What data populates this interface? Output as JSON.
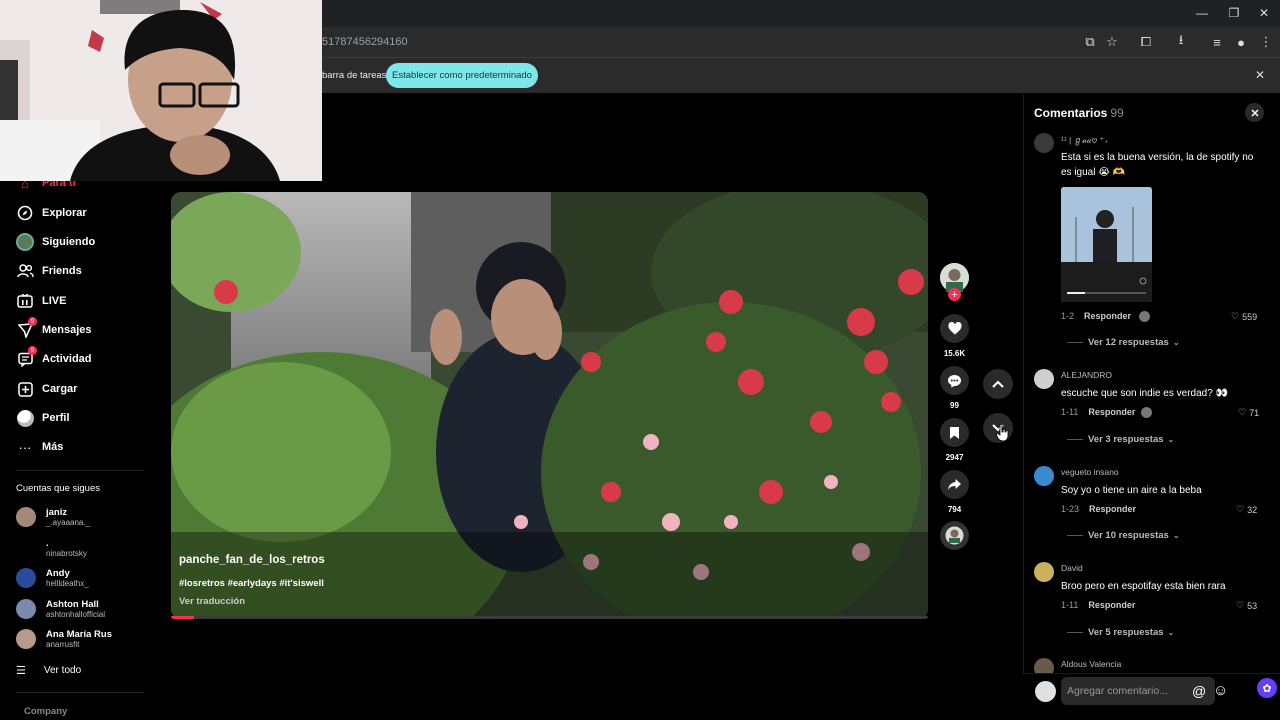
{
  "browser": {
    "url_partial": "51787456294160",
    "infobar_text": "barra de tareas",
    "set_default_label": "Establecer como predeterminado"
  },
  "sidebar": {
    "items": [
      {
        "label": "Para ti",
        "icon": "home-icon",
        "badge": ""
      },
      {
        "label": "Explorar",
        "icon": "compass-icon",
        "badge": ""
      },
      {
        "label": "Siguiendo",
        "icon": "following-avatar-icon",
        "badge": ""
      },
      {
        "label": "Friends",
        "icon": "friends-icon",
        "badge": ""
      },
      {
        "label": "LIVE",
        "icon": "live-icon",
        "badge": ""
      },
      {
        "label": "Mensajes",
        "icon": "messages-icon",
        "badge": "9"
      },
      {
        "label": "Actividad",
        "icon": "activity-icon",
        "badge": "9"
      },
      {
        "label": "Cargar",
        "icon": "upload-icon",
        "badge": ""
      },
      {
        "label": "Perfil",
        "icon": "profile-icon",
        "badge": ""
      },
      {
        "label": "Más",
        "icon": "more-icon",
        "badge": ""
      }
    ],
    "following_title": "Cuentas que sigues",
    "accounts": [
      {
        "name": "janiz",
        "handle": "_.ayaaana._"
      },
      {
        "name": ".",
        "handle": "ninabrotsky"
      },
      {
        "name": "Andy",
        "handle": "hellldeathx_"
      },
      {
        "name": "Ashton Hall",
        "handle": "ashtonhallofficial"
      },
      {
        "name": "Ana María Rus",
        "handle": "anarrusfit"
      }
    ],
    "see_all": "Ver todo",
    "company": "Company"
  },
  "video": {
    "username": "panche_fan_de_los_retros",
    "tags": "#losretros #earlydays #it'siswell",
    "translate": "Ver traducción",
    "progress": 0.03
  },
  "actions": {
    "likes": "15.6K",
    "comments": "99",
    "saves": "2947",
    "shares": "794"
  },
  "comments_panel": {
    "title": "Comentarios",
    "count": "99",
    "input_placeholder": "Agregar comentario...",
    "items": [
      {
        "user": "¹¹ | ℊ𝓊𝒶𖹭 ⁺₊",
        "text": "Esta si es la buena versión, la de spotify no es igual 😭 🫶",
        "date": "1-2",
        "reply": "Responder",
        "likes": "559",
        "more": "Ver 12 respuestas"
      },
      {
        "user": "ALEJANDRO",
        "text": "escuche que son indie es verdad? 👀",
        "date": "1-11",
        "reply": "Responder",
        "likes": "71",
        "more": "Ver 3 respuestas"
      },
      {
        "user": "vegueto insano",
        "text": "Soy yo o tiene un aire a la beba",
        "date": "1-23",
        "reply": "Responder",
        "likes": "32",
        "more": "Ver 10 respuestas"
      },
      {
        "user": "David",
        "text": "Broo pero en espotifay esta bien rara",
        "date": "1-11",
        "reply": "Responder",
        "likes": "53",
        "more": "Ver 5 respuestas"
      },
      {
        "user": "Aldous Valencia",
        "text": "",
        "date": "",
        "reply": "",
        "likes": "",
        "more": ""
      }
    ]
  }
}
